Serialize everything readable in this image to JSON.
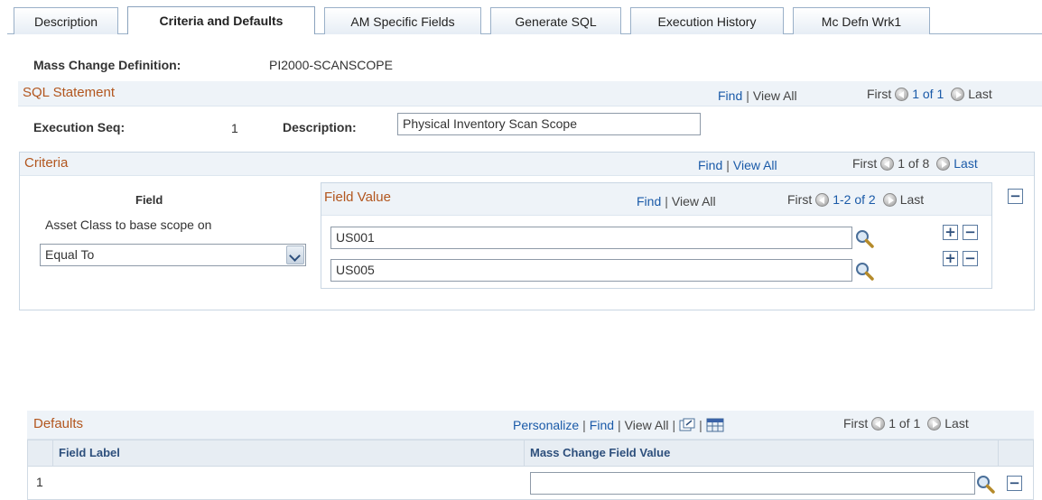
{
  "tabs": [
    {
      "label": "Description",
      "active": false
    },
    {
      "label": "Criteria and Defaults",
      "active": true
    },
    {
      "label": "AM Specific Fields",
      "active": false
    },
    {
      "label": "Generate SQL",
      "active": false
    },
    {
      "label": "Execution History",
      "active": false
    },
    {
      "label": "Mc Defn Wrk1",
      "active": false
    }
  ],
  "header": {
    "definition_label": "Mass Change Definition:",
    "definition_value": "PI2000-SCANSCOPE"
  },
  "sql": {
    "title": "SQL Statement",
    "find": "Find",
    "sep": "|",
    "view_all": "View All",
    "first": "First",
    "count": "1 of 1",
    "last": "Last",
    "exec_seq_label": "Execution Seq:",
    "exec_seq_value": "1",
    "description_label": "Description:",
    "description_value": "Physical Inventory Scan Scope"
  },
  "criteria": {
    "title": "Criteria",
    "find": "Find",
    "sep": "|",
    "view_all": "View All",
    "first": "First",
    "count": "1 of 8",
    "last": "Last",
    "field_header": "Field",
    "field_name": "Asset Class to base scope on",
    "operator": "Equal To",
    "field_value": {
      "title": "Field Value",
      "find": "Find",
      "sep": "|",
      "view_all": "View All",
      "first": "First",
      "count": "1-2 of 2",
      "last": "Last",
      "rows": [
        "US001",
        "US005"
      ]
    }
  },
  "defaults": {
    "title": "Defaults",
    "personalize": "Personalize",
    "sep": "|",
    "find": "Find",
    "view_all": "View All",
    "first": "First",
    "count": "1 of 1",
    "last": "Last",
    "col_field_label": "Field Label",
    "col_mass_change": "Mass Change Field Value",
    "rows": [
      {
        "num": "1",
        "field_label": "",
        "value": ""
      }
    ]
  },
  "icons": {
    "lookup": "magnifier-icon",
    "add": "plus-icon",
    "delete": "minus-icon",
    "prev": "left-arrow-icon",
    "next": "right-arrow-icon",
    "zoom": "new-window-icon",
    "download": "spreadsheet-icon"
  },
  "colors": {
    "section_title": "#b2561e",
    "link": "#1a5aa8",
    "header_bg": "#eef3f8"
  }
}
